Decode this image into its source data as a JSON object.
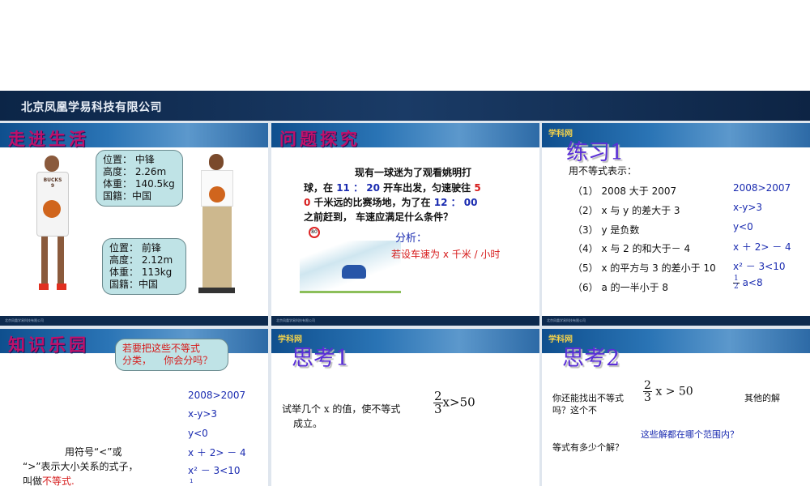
{
  "company": "北京凤凰学易科技有限公司",
  "logo": "学科网",
  "slides": [
    {
      "title": "走进生活",
      "bubble1": [
        "位置： 中锋",
        "高度： 2.26m",
        "体重： 140.5kg",
        "国籍：中国"
      ],
      "bubble2": [
        "位置： 前锋",
        "高度： 2.12m",
        "体重： 113kg",
        "国籍：中国"
      ],
      "jersey": "BUCKS 9"
    },
    {
      "title": "问题探究",
      "lines": [
        "现有一球迷为了观看姚明打",
        "球，在",
        "11 ： 20",
        "开车出发，匀速驶往",
        "5",
        "0",
        "千米远的比赛场地，为了在",
        "12 ： 00",
        "之前赶到， 车速应满足什么条件？"
      ],
      "analysis": "分析：",
      "assume": "若设车速为 x 千米 / 小时",
      "sign": "80"
    },
    {
      "title": "练习1",
      "intro": "用不等式表示：",
      "items": [
        "（1） 2008 大于 2007",
        "（2） x 与 y 的差大于 3",
        "（3） y 是负数",
        "（4） x 与 2 的和大于－ 4",
        "（5） x 的平方与 3 的差小于 10",
        "（6） a 的一半小于 8"
      ],
      "answers": [
        "2008>2007",
        "x-y>3",
        "y<0",
        "x ＋ 2> － 4",
        "x² － 3<10",
        "a<8"
      ],
      "frac": [
        "1",
        "2"
      ]
    },
    {
      "title": "知识乐园",
      "bubble": [
        "若要把这些不等式",
        "分类，    你会分吗？"
      ],
      "answers": [
        "2008>2007",
        "x-y>3",
        "y<0",
        "x ＋ 2> － 4",
        "x² － 3<10",
        "1"
      ],
      "def1": "用符号“<”或",
      "def2": "“>”表示大小关系的式子，",
      "def3a": "叫做",
      "def3b": "不等式",
      "def3c": "."
    },
    {
      "title": "思考1",
      "q1": "试举几个 x 的值，使不等式",
      "q2": "成立。",
      "frac": [
        "2",
        "3"
      ],
      "expr": "x>50"
    },
    {
      "title": "思考2",
      "q1": "你还能找出不等式",
      "q1b": "其他的解",
      "q2": "吗？这个不",
      "q3": "等式有多少个解？",
      "q4": "这些解都在哪个范围内？",
      "frac": [
        "2",
        "3"
      ],
      "expr": "x > 50"
    }
  ]
}
